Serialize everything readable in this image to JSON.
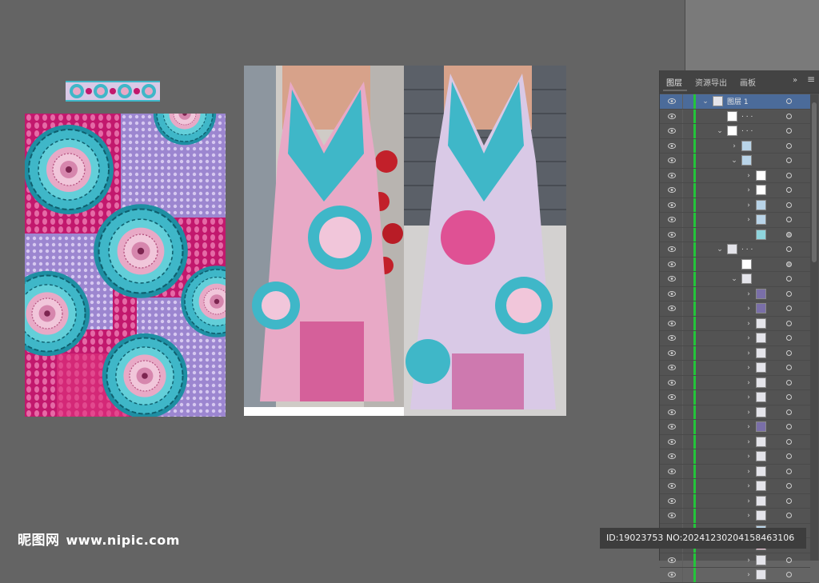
{
  "panel": {
    "tabs": [
      "图层",
      "资源导出",
      "画板"
    ],
    "menu_glyph": "»",
    "layer_name": "图层 1",
    "sub_label": ". . ."
  },
  "watermark": {
    "logo_text": "昵图网",
    "url": "www.nipic.com",
    "id_text": "ID:19023753 NO:20241230204158463106"
  },
  "colors": {
    "pink": "#e0337f",
    "magenta": "#c2186d",
    "teal": "#3fb7c8",
    "lavender": "#a58ed6",
    "selected_row": "#4b6b9a",
    "green_bar": "#24c43a"
  },
  "icons": [
    "eye-icon",
    "chevron-right-icon",
    "chevron-down-icon",
    "target-circle-icon",
    "panel-menu-icon"
  ]
}
